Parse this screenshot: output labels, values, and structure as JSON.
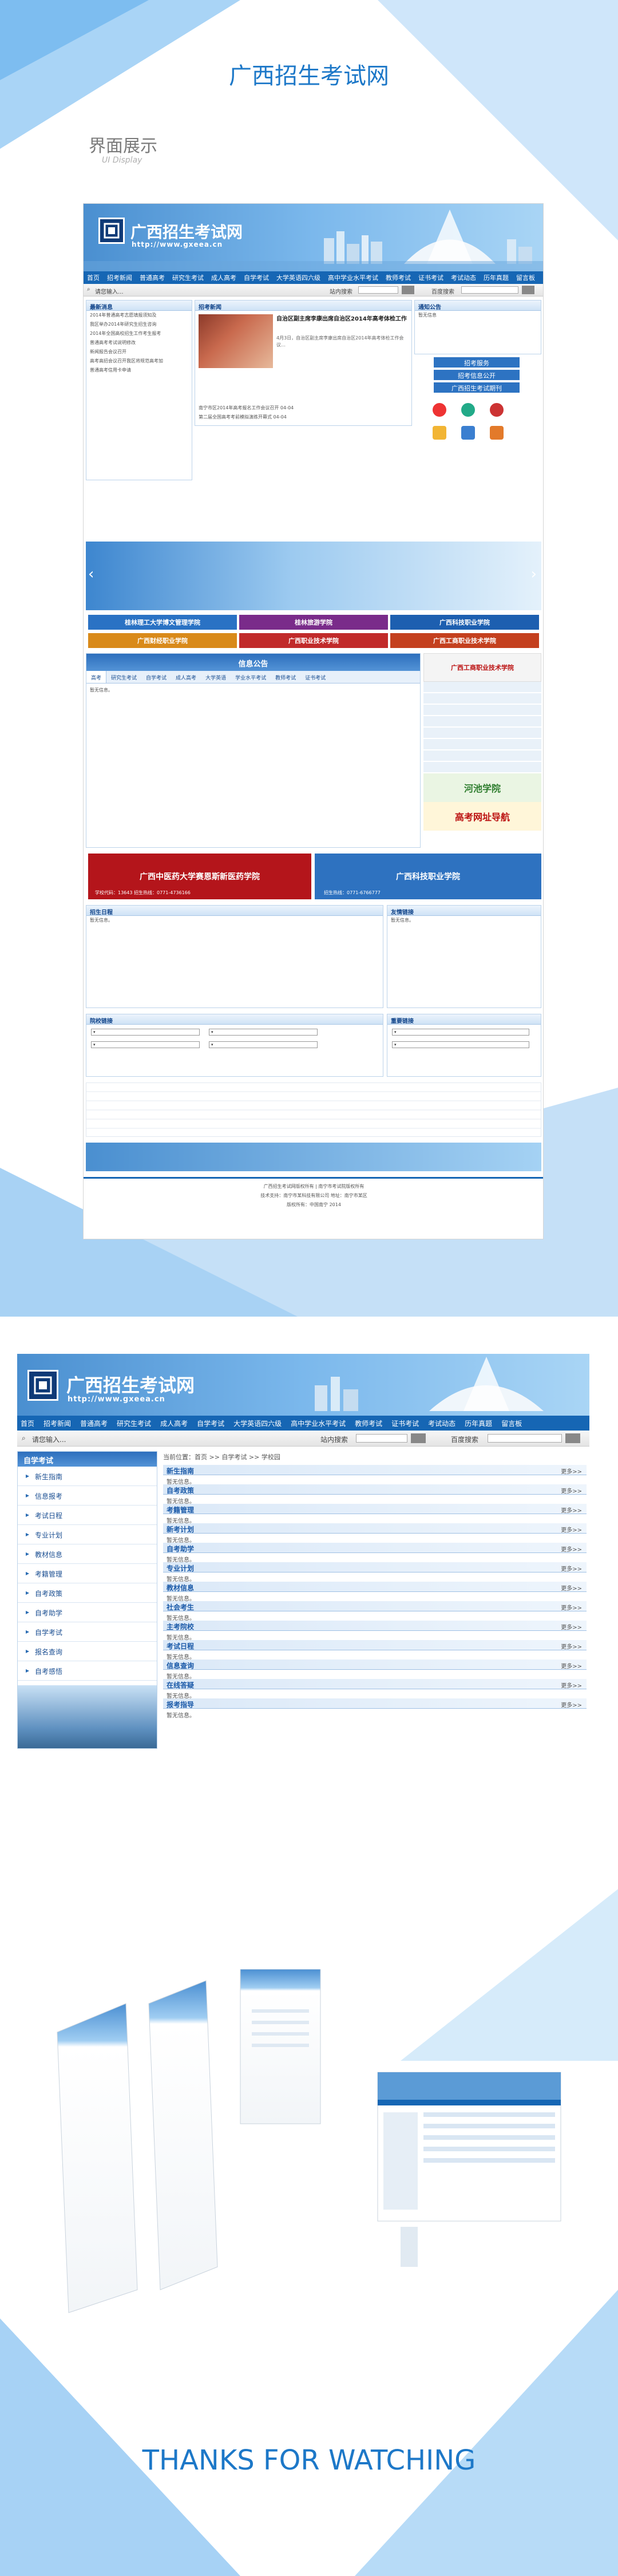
{
  "header": {
    "title": "广西招生考试网",
    "section_title": "界面展示",
    "section_sub": "UI Display"
  },
  "site": {
    "name": "广西招生考试网",
    "url": "http://www.gxeea.cn",
    "nav": [
      "首页",
      "招考新闻",
      "普通高考",
      "研究生考试",
      "成人高考",
      "自学考试",
      "大学英语四六级",
      "高中学业水平考试",
      "教师考试",
      "证书考试",
      "考试动态",
      "历年真题",
      "留言板"
    ],
    "search_placeholder": "请您输入...",
    "search_label": "站内搜索",
    "search_button": "搜索",
    "baidu_label": "百度搜索"
  },
  "home": {
    "latest_title": "最新消息",
    "latest_items": [
      "2014年普通高考志愿填报须知及",
      "我区举办2014年研究生招生咨询",
      "2014年全国高校招生工作考生报考",
      "普通高考考试说明修改",
      "新闻报告会议召开",
      "高考高招会议召开我区将规范高考加",
      "普通高考信用卡申请"
    ],
    "news_title": "招考新闻",
    "news_headline": "自治区副主席李康出席自治区2014年高考体检工作",
    "news_body": "4月3日，自治区副主席李康出席自治区2014年高考体检工作会议…",
    "news_links": [
      "南宁市区2014年高考报名工作会议召开 04-04",
      "第二届全国高考考前模拟演练开幕式 04-04"
    ],
    "notice_title": "通知公告",
    "notice_body": "暂无信息",
    "quick_links": [
      "招考服务",
      "招考信息公开",
      "广西招生考试期刊"
    ],
    "info_title": "信息公告",
    "tabs": [
      "高考",
      "研究生考试",
      "自学考试",
      "成人高考",
      "大学英语",
      "学业水平考试",
      "教师考试",
      "证书考试"
    ],
    "info_body": "暂无信息。",
    "schedule_title": "招生日程",
    "links_title": "友情链接",
    "placeholder": "暂无信息。",
    "service_title": "院校链接",
    "special_title": "重要链接",
    "footer": [
      "广西招生考试网版权所有 | 南宁市考试院版权所有",
      "技术支持：南宁市某科技有限公司  地址：南宁市某区",
      "版权所有：中国南宁 2014"
    ]
  },
  "ads": [
    "桂林理工大学博文管理学院",
    "桂林旅游学院",
    "广西科技职业学院",
    "广西财经职业学院",
    "广西职业技术学院",
    "广西中医药大学赛恩斯新医药学院",
    "广西科技职业学院",
    "河池学院",
    "高考网址导航",
    "广西工商职业技术学院"
  ],
  "ad_codes": [
    "学校代码：13643   招生热线：0771-4736166",
    "招生热线：0771-6766777"
  ],
  "sub": {
    "section_title": "自学考试",
    "sidebar_items": [
      "新生指南",
      "信息报考",
      "考试日程",
      "专业计划",
      "教材信息",
      "考籍管理",
      "自考政策",
      "自考助学",
      "自学考试",
      "报名查询",
      "自考感悟"
    ],
    "breadcrumb": "当前位置：首页 >> 自学考试 >> 学校园",
    "sections": [
      "新生指南",
      "自考政策",
      "考籍管理",
      "新考计划",
      "自考助学",
      "专业计划",
      "教材信息",
      "社会考生",
      "主考院校",
      "考试日程",
      "信息查询",
      "在线答疑",
      "报考指导"
    ],
    "more": "更多>>",
    "empty": "暂无信息。"
  },
  "footer": {
    "thanks": "THANKS FOR WATCHING"
  },
  "colors": {
    "brand_blue": "#1d78c8",
    "nav_blue": "#1666b4",
    "light_blue_bg": "#bcd9f3"
  }
}
